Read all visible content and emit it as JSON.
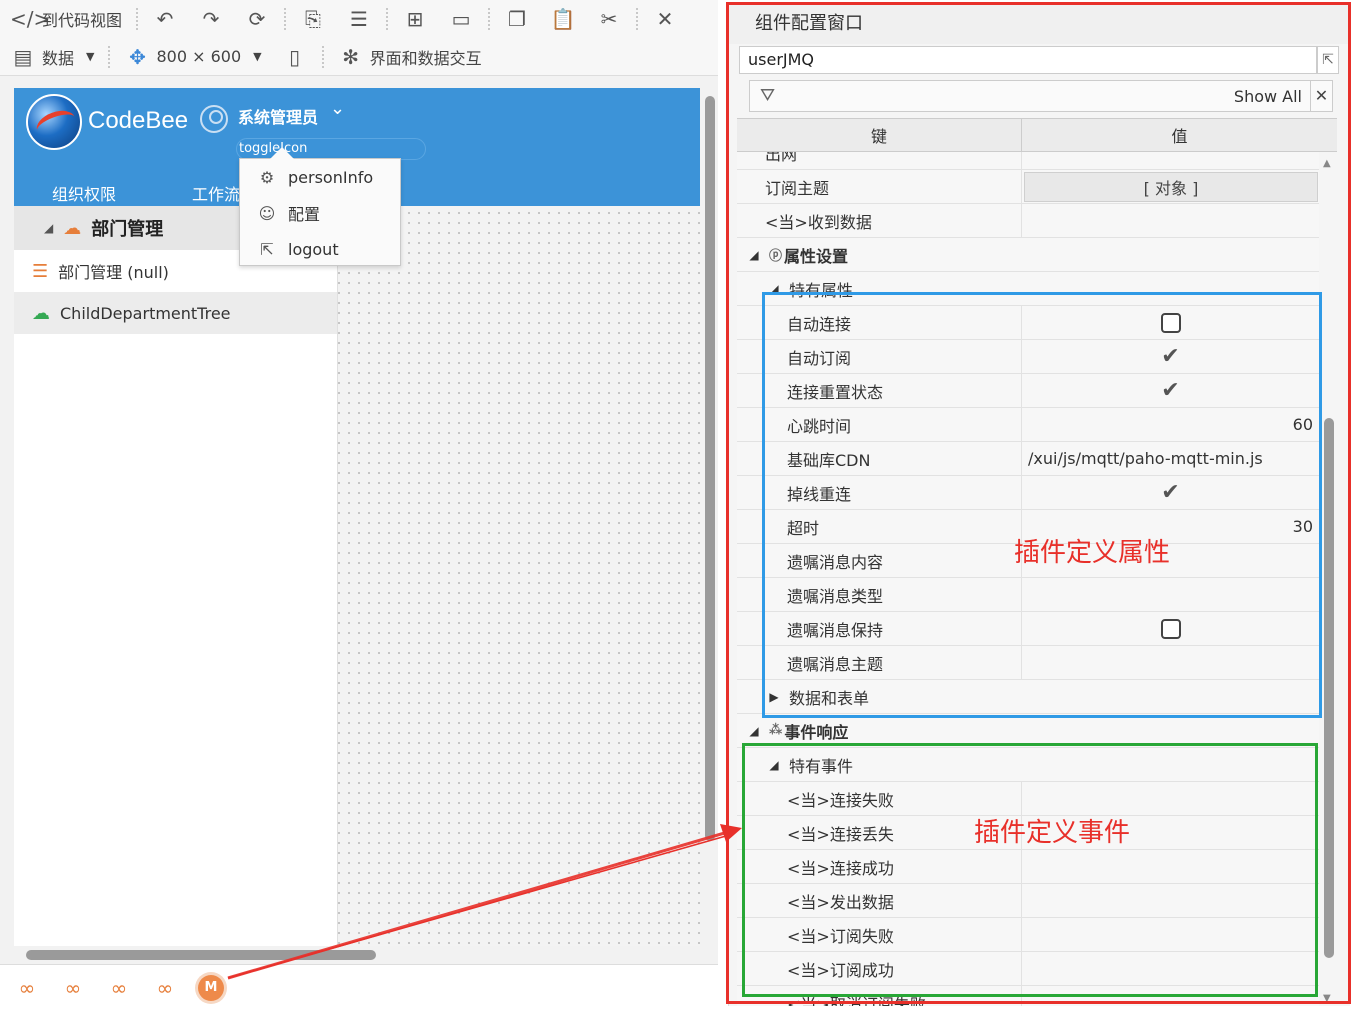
{
  "toolbar": {
    "row1": [
      {
        "icon": "code-icon",
        "glyph": "</>",
        "label": "到代码视图"
      },
      {
        "icon": "undo-icon",
        "glyph": "↶",
        "label": ""
      },
      {
        "icon": "redo-icon",
        "glyph": "↷",
        "label": ""
      },
      {
        "icon": "refresh-icon",
        "glyph": "⟳",
        "label": ""
      },
      {
        "icon": "preview-icon",
        "glyph": "⎘",
        "label": ""
      },
      {
        "icon": "list-icon",
        "glyph": "☰",
        "label": ""
      },
      {
        "icon": "align-icon",
        "glyph": "⊞",
        "label": ""
      },
      {
        "icon": "frame-icon",
        "glyph": "▭",
        "label": ""
      },
      {
        "icon": "copy-icon",
        "glyph": "❐",
        "label": ""
      },
      {
        "icon": "paste-icon",
        "glyph": "📋",
        "label": ""
      },
      {
        "icon": "cut-icon",
        "glyph": "✂",
        "label": ""
      },
      {
        "icon": "delete-icon",
        "glyph": "✕",
        "label": ""
      }
    ],
    "data_label": "数据",
    "size_label": "800 × 600",
    "interact_label": "界面和数据交互"
  },
  "app": {
    "brand": "CodeBee",
    "user_name": "系统管理员",
    "toggle_text": "toggleIcon",
    "nav": [
      "组织权限",
      "工作流"
    ],
    "dropdown": [
      {
        "icon": "gear-icon",
        "glyph": "⚙",
        "label": "personInfo"
      },
      {
        "icon": "smile-icon",
        "glyph": "☺",
        "label": "配置"
      },
      {
        "icon": "external-link-icon",
        "glyph": "⇱",
        "label": "logout"
      }
    ],
    "tree_title": "部门管理",
    "tree_items": [
      {
        "label": "部门管理 (null)",
        "icon": "org-icon"
      },
      {
        "label": "ChildDepartmentTree",
        "icon": "cloud-icon"
      }
    ]
  },
  "panel": {
    "title": "组件配置窗口",
    "component": "userJMQ",
    "show_all": "Show All",
    "col_key": "键",
    "col_value": "值",
    "rows": [
      {
        "key": "出网",
        "value": "",
        "type": "text",
        "indent": 1
      },
      {
        "key": "订阅主题",
        "value": "[ 对象 ]",
        "type": "object",
        "indent": 1
      },
      {
        "key": "<当>收到数据",
        "value": "",
        "type": "text",
        "indent": 1
      },
      {
        "key": "属性设置",
        "value": "",
        "type": "group",
        "indent": 0
      },
      {
        "key": "特有属性",
        "value": "",
        "type": "sub",
        "indent": 1
      },
      {
        "key": "自动连接",
        "value": "false",
        "type": "checkbox",
        "indent": 2
      },
      {
        "key": "自动订阅",
        "value": "true",
        "type": "checkbox",
        "indent": 2
      },
      {
        "key": "连接重置状态",
        "value": "true",
        "type": "checkbox",
        "indent": 2
      },
      {
        "key": "心跳时间",
        "value": "60",
        "type": "number",
        "indent": 2
      },
      {
        "key": "基础库CDN",
        "value": "/xui/js/mqtt/paho-mqtt-min.js",
        "type": "text",
        "indent": 2
      },
      {
        "key": "掉线重连",
        "value": "true",
        "type": "checkbox",
        "indent": 2
      },
      {
        "key": "超时",
        "value": "30",
        "type": "number",
        "indent": 2
      },
      {
        "key": "遗嘱消息内容",
        "value": "",
        "type": "text",
        "indent": 2
      },
      {
        "key": "遗嘱消息类型",
        "value": "",
        "type": "text",
        "indent": 2
      },
      {
        "key": "遗嘱消息保持",
        "value": "false",
        "type": "checkbox",
        "indent": 2
      },
      {
        "key": "遗嘱消息主题",
        "value": "",
        "type": "text",
        "indent": 2
      },
      {
        "key": "数据和表单",
        "value": "",
        "type": "collapsed",
        "indent": 1
      },
      {
        "key": "事件响应",
        "value": "",
        "type": "group-event",
        "indent": 0
      },
      {
        "key": "特有事件",
        "value": "",
        "type": "sub",
        "indent": 1
      },
      {
        "key": "<当>连接失败",
        "value": "",
        "type": "text",
        "indent": 2
      },
      {
        "key": "<当>连接丢失",
        "value": "",
        "type": "text",
        "indent": 2
      },
      {
        "key": "<当>连接成功",
        "value": "",
        "type": "text",
        "indent": 2
      },
      {
        "key": "<当>发出数据",
        "value": "",
        "type": "text",
        "indent": 2
      },
      {
        "key": "<当>订阅失败",
        "value": "",
        "type": "text",
        "indent": 2
      },
      {
        "key": "<当>订阅成功",
        "value": "",
        "type": "text",
        "indent": 2
      },
      {
        "key": "<当>取消订阅失败",
        "value": "",
        "type": "text",
        "indent": 2
      }
    ]
  },
  "annotations": {
    "props_label": "插件定义属性",
    "events_label": "插件定义事件",
    "red": "#e8302a",
    "blue": "#2f9ae6",
    "green": "#28a736"
  }
}
